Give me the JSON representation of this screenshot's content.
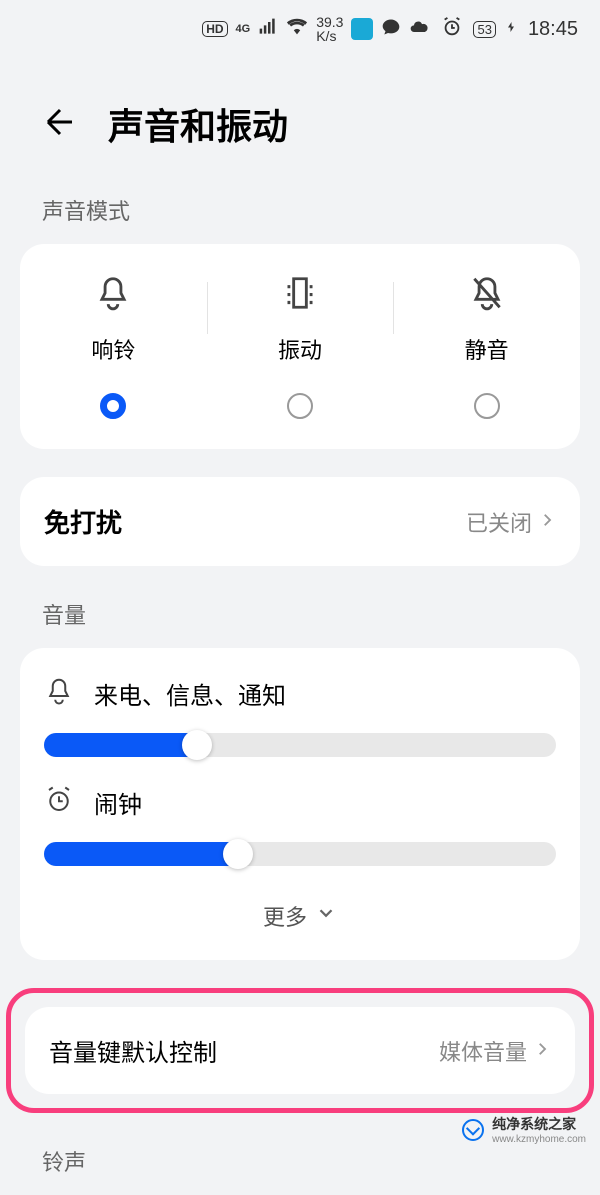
{
  "status_bar": {
    "hd_badge": "HD",
    "net_gen": "4G",
    "net_speed_top": "39.3",
    "net_speed_bot": "K/s",
    "battery": "53",
    "time": "18:45"
  },
  "page_title": "声音和振动",
  "sections": {
    "sound_mode": {
      "label": "声音模式",
      "modes": [
        {
          "name": "ring",
          "label": "响铃",
          "selected": true
        },
        {
          "name": "vibrate",
          "label": "振动",
          "selected": false
        },
        {
          "name": "mute",
          "label": "静音",
          "selected": false
        }
      ]
    },
    "dnd": {
      "title": "免打扰",
      "value": "已关闭"
    },
    "volume": {
      "label": "音量",
      "sliders": [
        {
          "name": "ring-notif",
          "label": "来电、信息、通知",
          "percent": 30
        },
        {
          "name": "alarm",
          "label": "闹钟",
          "percent": 38
        }
      ],
      "more_label": "更多"
    },
    "volume_key": {
      "title": "音量键默认控制",
      "value": "媒体音量"
    },
    "ringtone_label": "铃声"
  },
  "watermark": {
    "main": "纯净系统之家",
    "url": "www.kzmyhome.com"
  }
}
